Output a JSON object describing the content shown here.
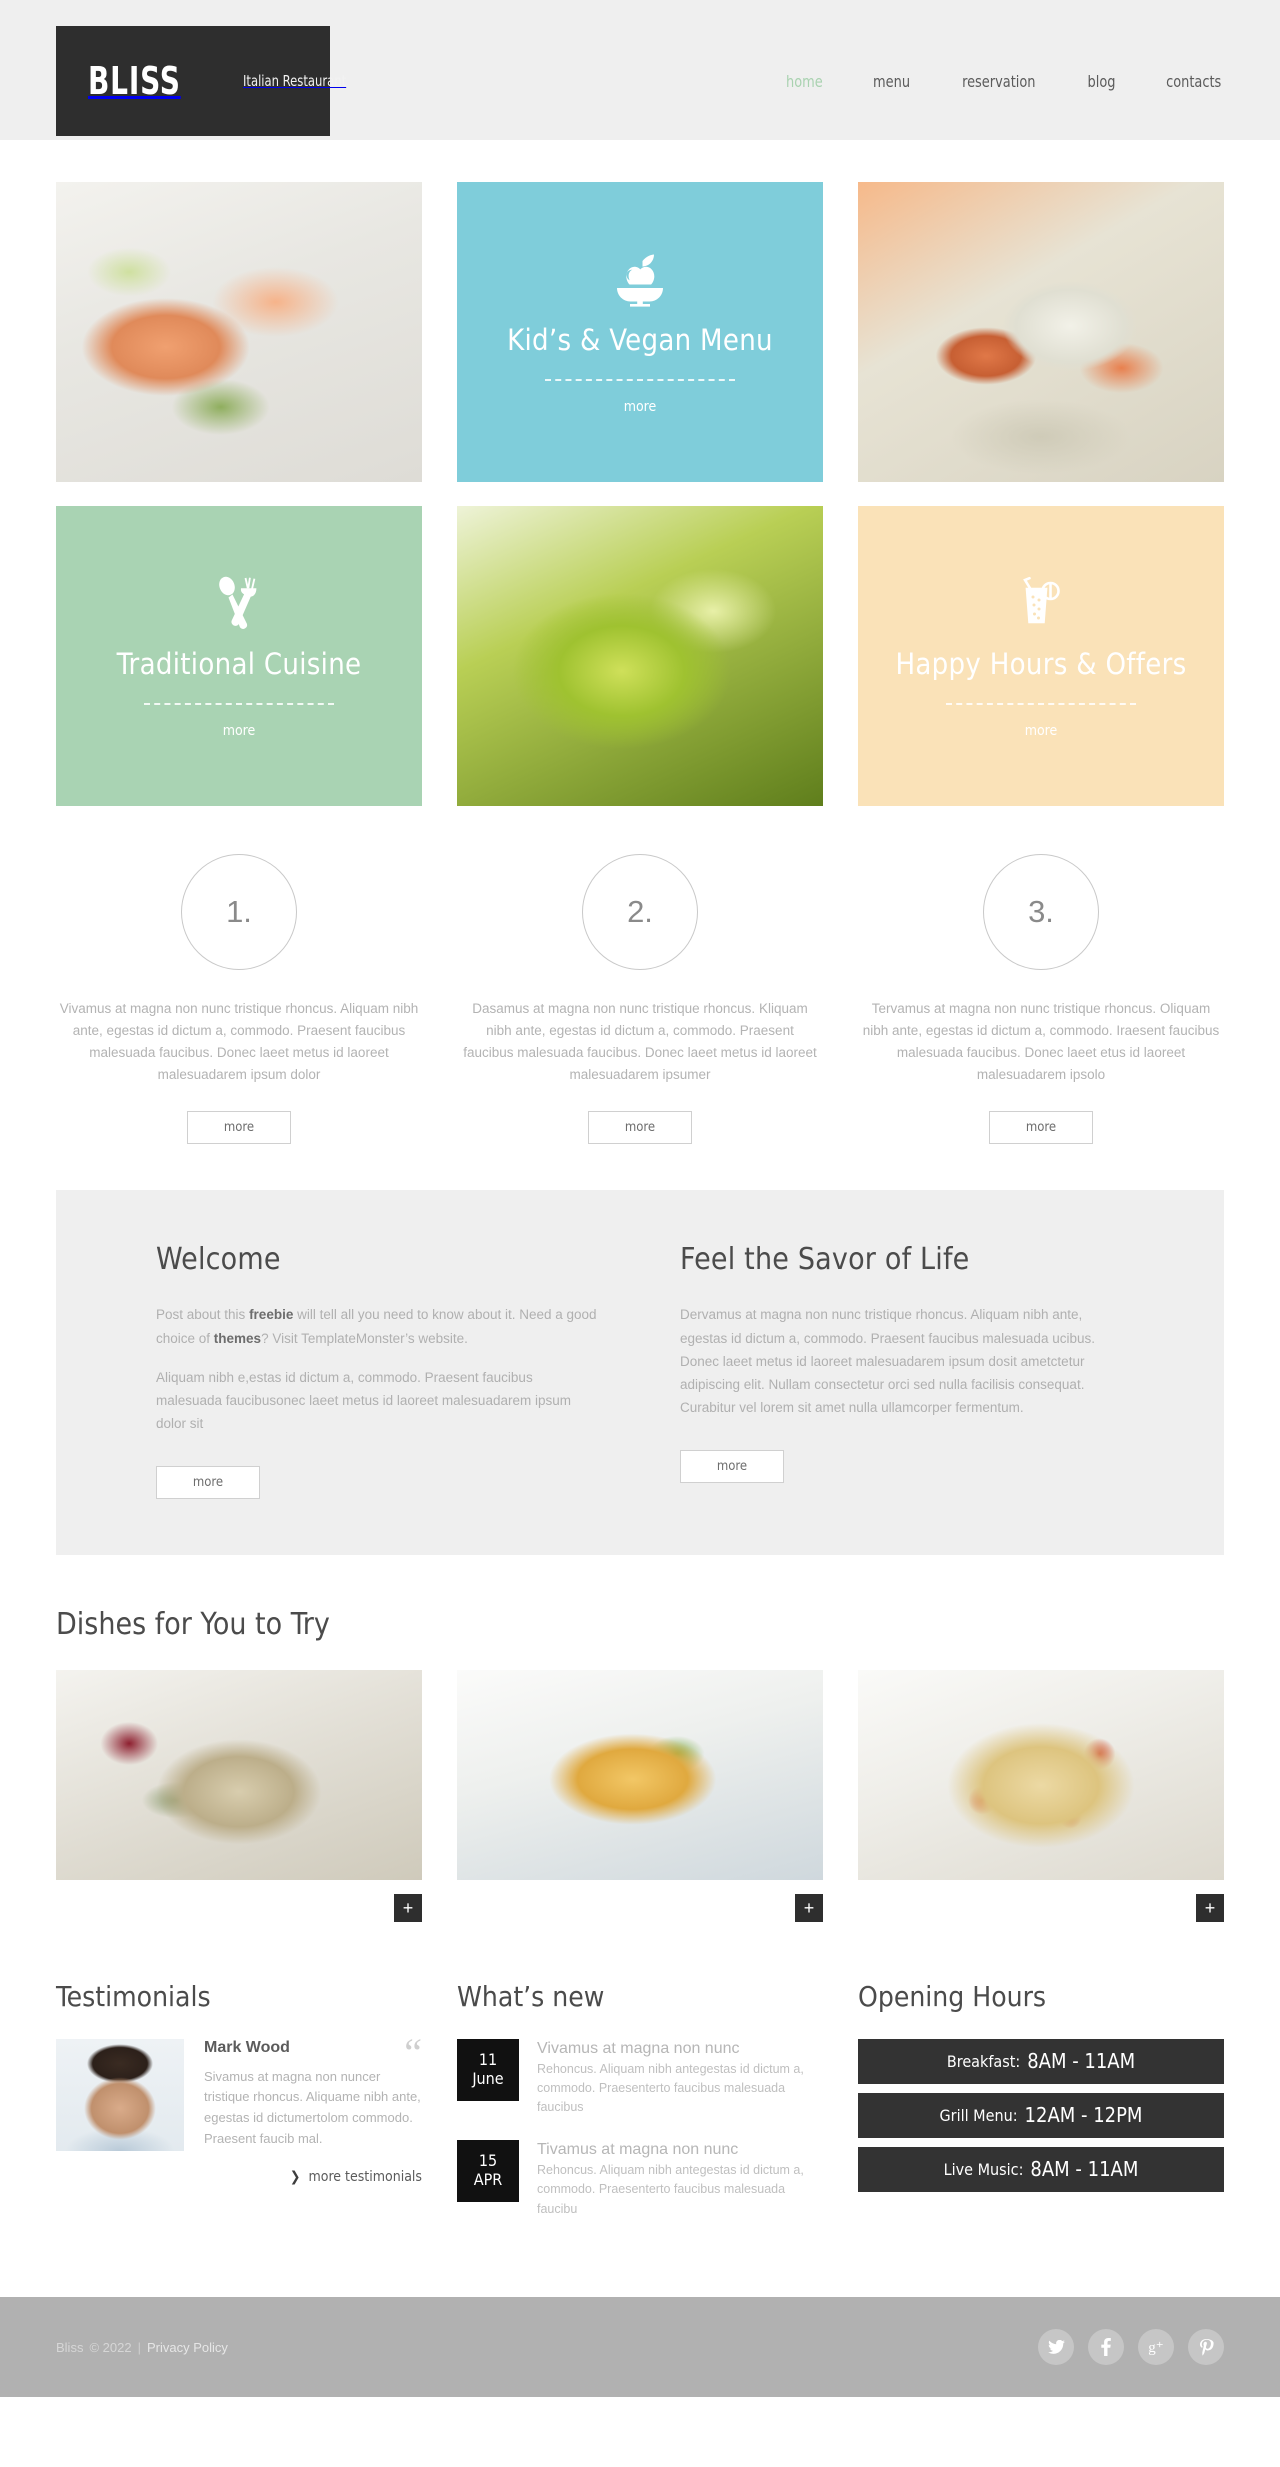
{
  "header": {
    "logo_name": "BLISS",
    "logo_tagline": "Italian Restaurant",
    "nav": [
      {
        "label": "home",
        "active": true
      },
      {
        "label": "menu",
        "active": false
      },
      {
        "label": "reservation",
        "active": false
      },
      {
        "label": "blog",
        "active": false
      },
      {
        "label": "contacts",
        "active": false
      }
    ]
  },
  "tiles": [
    {
      "kind": "photo",
      "name": "salmon-dish",
      "alt": "Smoked salmon plate"
    },
    {
      "kind": "color",
      "name": "kids-vegan",
      "icon": "apple-bowl-icon",
      "title": "Kid’s & Vegan Menu",
      "more": "more",
      "color": "#7fcdda"
    },
    {
      "kind": "photo",
      "name": "shrimp-scallop-dish",
      "alt": "Shrimp and scallop plate"
    },
    {
      "kind": "color",
      "name": "traditional-cuisine",
      "icon": "fork-spoon-icon",
      "title": "Traditional Cuisine",
      "more": "more",
      "color": "#a9d3b3"
    },
    {
      "kind": "photo",
      "name": "green-pasta",
      "alt": "Green pasta close-up"
    },
    {
      "kind": "color",
      "name": "happy-hours",
      "icon": "drink-glass-icon",
      "title": "Happy Hours & Offers",
      "more": "more",
      "color": "#fae2b8"
    }
  ],
  "steps": [
    {
      "number": "1.",
      "text": "Vivamus at magna non nunc tristique rhoncus. Aliquam nibh ante, egestas id dictum a, commodo. Praesent faucibus malesuada faucibus. Donec laeet metus id laoreet malesuadarem ipsum dolor",
      "more": "more"
    },
    {
      "number": "2.",
      "text": "Dasamus at magna non nunc tristique rhoncus. Kliquam nibh ante, egestas id dictum a, commodo. Praesent faucibus malesuada faucibus. Donec laeet metus id laoreet malesuadarem ipsumer",
      "more": "more"
    },
    {
      "number": "3.",
      "text": "Tervamus at magna non nunc tristique rhoncus. Oliquam nibh ante, egestas id dictum a, commodo. Iraesent faucibus malesuada faucibus. Donec laeet etus id laoreet malesuadarem ipsolo",
      "more": "more"
    }
  ],
  "welcome": {
    "title": "Welcome",
    "p1_a": "Post about this ",
    "p1_b": "freebie",
    "p1_c": " will tell all you need to know about it. Need a good choice of ",
    "p1_d": "themes",
    "p1_e": "? Visit TemplateMonster’s website.",
    "p2": "Aliquam nibh e,estas id dictum a, commodo. Praesent faucibus malesuada faucibusonec laeet metus id laoreet malesuadarem ipsum dolor sit",
    "more": "more"
  },
  "savor": {
    "title": "Feel the Savor of Life",
    "p1": "Dervamus at magna non nunc tristique rhoncus. Aliquam nibh ante, egestas id dictum a, commodo. Praesent faucibus malesuada ucibus. Donec laeet metus id laoreet malesuadarem ipsum dosit ametctetur adipiscing elit. Nullam consectetur orci sed nulla facilisis consequat. Curabitur vel lorem sit amet nulla ullamcorper fermentum.",
    "more": "more"
  },
  "dishes": {
    "title": "Dishes for You to Try",
    "items": [
      {
        "name": "grilled-seafood-salad",
        "plus": "+"
      },
      {
        "name": "fruit-dessert-tart",
        "plus": "+"
      },
      {
        "name": "tomato-spaghetti",
        "plus": "+"
      }
    ]
  },
  "testimonials": {
    "title": "Testimonials",
    "author": "Mark Wood",
    "quote_mark": "“",
    "text": "Sivamus at magna non nuncer tristique rhoncus. Aliquame nibh ante, egestas id dictumertolom commodo. Praesent faucib mal.",
    "more_link": "more testimonials",
    "chevron": "❯"
  },
  "news": {
    "title": "What’s new",
    "items": [
      {
        "day": "11",
        "month": "June",
        "title": "Vivamus at magna non nunc",
        "text": "Rehoncus. Aliquam nibh antegestas id dictum a, commodo. Praesenterto faucibus malesuada faucibus"
      },
      {
        "day": "15",
        "month": "APR",
        "title": "Tivamus at magna non nunc",
        "text": "Rehoncus. Aliquam nibh antegestas id dictum a, commodo. Praesenterto faucibus malesuada faucibu"
      }
    ]
  },
  "hours": {
    "title": "Opening Hours",
    "rows": [
      {
        "label": "Breakfast:",
        "value": "8AM - 11AM"
      },
      {
        "label": "Grill Menu:",
        "value": "12AM - 12PM"
      },
      {
        "label": "Live Music:",
        "value": "8AM - 11AM"
      }
    ]
  },
  "footer": {
    "brand": "Bliss",
    "copyright": "© 2022",
    "separator": "|",
    "privacy": "Privacy Policy",
    "socials": [
      {
        "name": "twitter-icon",
        "glyph": "ᵗ"
      },
      {
        "name": "facebook-icon",
        "glyph": "f"
      },
      {
        "name": "google-plus-icon",
        "glyph": "g⁺"
      },
      {
        "name": "pinterest-icon",
        "glyph": "℘"
      }
    ]
  },
  "colors": {
    "header_bg": "#efefef",
    "logo_bg": "#2e2e2e",
    "accent_green": "#a9d2b0",
    "tile_blue": "#7fcdda",
    "tile_green": "#a9d3b3",
    "tile_peach": "#fae2b8",
    "dark": "#333333",
    "footer_bg": "#b1b1b1"
  }
}
